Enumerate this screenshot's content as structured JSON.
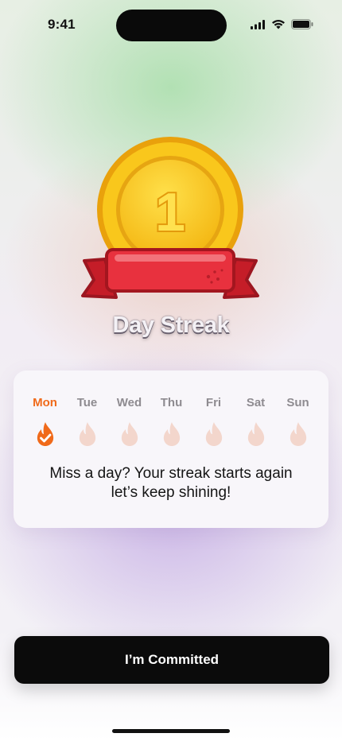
{
  "status_bar": {
    "time": "9:41"
  },
  "medal": {
    "number": "1"
  },
  "title": "Day Streak",
  "week": {
    "days": [
      {
        "label": "Mon",
        "state": "done"
      },
      {
        "label": "Tue",
        "state": "pending"
      },
      {
        "label": "Wed",
        "state": "pending"
      },
      {
        "label": "Thu",
        "state": "pending"
      },
      {
        "label": "Fri",
        "state": "pending"
      },
      {
        "label": "Sat",
        "state": "pending"
      },
      {
        "label": "Sun",
        "state": "pending"
      }
    ]
  },
  "message": {
    "line1": "Miss a day? Your streak starts again",
    "line2": "let’s keep shining!"
  },
  "cta": {
    "label": "I’m Committed"
  },
  "colors": {
    "accent": "#f06a1a",
    "flame_inactive": "#f3d6cc",
    "medal_gold": "#f8c81c",
    "ribbon_red": "#e8313e",
    "button_bg": "#0b0b0b"
  },
  "icons": [
    "signal-icon",
    "wifi-icon",
    "battery-icon",
    "flame-check-icon",
    "flame-icon"
  ]
}
